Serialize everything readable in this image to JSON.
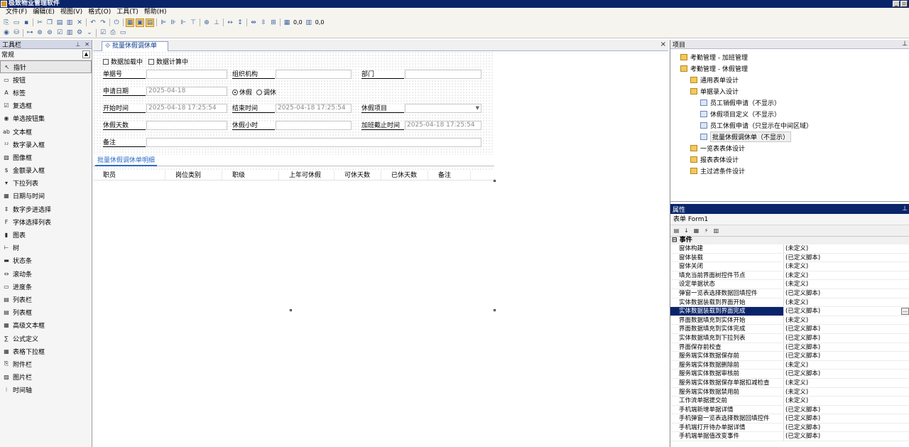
{
  "window": {
    "title": "极致物业管理软件"
  },
  "menu": [
    "文件(F)",
    "编辑(E)",
    "视图(V)",
    "格式(O)",
    "工具(T)",
    "帮助(H)"
  ],
  "toolbar": {
    "zoom_a": "0,0",
    "zoom_b": "0,0"
  },
  "toolbox": {
    "title": "工具栏",
    "category": "常规",
    "items": [
      "指针",
      "按钮",
      "标签",
      "复选框",
      "单选按钮集",
      "文本框",
      "数字录入框",
      "图像框",
      "金额录入框",
      "下拉列表",
      "日期与时间",
      "数字步进选择",
      "字体选择列表",
      "图表",
      "树",
      "状态条",
      "滚动条",
      "进度条",
      "列表栏",
      "列表框",
      "高级文本框",
      "公式定义",
      "表格下拉框",
      "附件栏",
      "图片栏",
      "时间轴"
    ]
  },
  "doc": {
    "tab_label": "批量休假调休单",
    "close_label": "×",
    "checks": [
      "数据加载中",
      "数据计算中"
    ],
    "fields": {
      "danju_hao": {
        "label": "单据号",
        "value": ""
      },
      "zuzhi": {
        "label": "组织机构",
        "value": ""
      },
      "bumen": {
        "label": "部门",
        "value": ""
      },
      "shenqing": {
        "label": "申请日期",
        "value": "2025-04-18"
      },
      "kaishi": {
        "label": "开始时间",
        "value": "2025-04-18 17:25:54"
      },
      "jieshu": {
        "label": "结束时间",
        "value": "2025-04-18 17:25:54"
      },
      "xiujia_xm": {
        "label": "休假项目",
        "value": ""
      },
      "tianshu": {
        "label": "休假天数",
        "value": ""
      },
      "xiaoshi": {
        "label": "休假小时",
        "value": ""
      },
      "jiaban_jz": {
        "label": "加班截止时间",
        "value": "2025-04-18 17:25:54"
      },
      "beizhu": {
        "label": "备注",
        "value": ""
      }
    },
    "radio": {
      "opt1": "休假",
      "opt2": "调休"
    },
    "detail_tab": "批量休假调休单明细",
    "grid_headers": [
      "职员",
      "岗位类别",
      "职级",
      "上年可休假",
      "可休天数",
      "已休天数",
      "备注"
    ]
  },
  "project": {
    "title": "项目",
    "tree": [
      {
        "label": "考勤管理 - 加班管理",
        "level": 0,
        "icon": "folder-open-icon"
      },
      {
        "label": "考勤管理 - 休假管理",
        "level": 0,
        "icon": "folder-open-icon"
      },
      {
        "label": "通用表单设计",
        "level": 1,
        "icon": "folder-icon"
      },
      {
        "label": "单据录入设计",
        "level": 1,
        "icon": "folder-icon"
      },
      {
        "label": "员工销假申请（不显示）",
        "level": 2,
        "icon": "page-icon"
      },
      {
        "label": "休假项目定义（不显示）",
        "level": 2,
        "icon": "page-icon"
      },
      {
        "label": "员工休假申请（只显示在中间区域）",
        "level": 2,
        "icon": "page-icon"
      },
      {
        "label": "批量休假调休单（不显示）",
        "level": 2,
        "icon": "page-icon",
        "selected": true
      },
      {
        "label": "一览表表体设计",
        "level": 1,
        "icon": "folder-icon"
      },
      {
        "label": "报表表体设计",
        "level": 1,
        "icon": "folder-icon"
      },
      {
        "label": "主过滤条件设计",
        "level": 1,
        "icon": "folder-icon"
      }
    ]
  },
  "props": {
    "title": "属性",
    "object": "表单 Form1",
    "category": "事件",
    "rows": [
      {
        "name": "窗体构建",
        "value": "(未定义)"
      },
      {
        "name": "窗体装载",
        "value": "(已定义脚本)"
      },
      {
        "name": "窗体关闭",
        "value": "(未定义)"
      },
      {
        "name": "填充当前界面树控件节点",
        "value": "(未定义)"
      },
      {
        "name": "设定单据状态",
        "value": "(未定义)"
      },
      {
        "name": "弹窗一览表选择数据回填控件",
        "value": "(已定义脚本)"
      },
      {
        "name": "实体数据装载到界面开始",
        "value": "(未定义)"
      },
      {
        "name": "实体数据装载到界面完成",
        "value": "(已定义脚本)",
        "selected": true
      },
      {
        "name": "界面数据填充到实体开始",
        "value": "(未定义)"
      },
      {
        "name": "界面数据填充到实体完成",
        "value": "(已定义脚本)"
      },
      {
        "name": "实体数据填充到下拉列表",
        "value": "(已定义脚本)"
      },
      {
        "name": "界面保存前校查",
        "value": "(已定义脚本)"
      },
      {
        "name": "服务端实体数据保存前",
        "value": "(已定义脚本)"
      },
      {
        "name": "服务端实体数据删除前",
        "value": "(未定义)"
      },
      {
        "name": "服务端实体数据审核前",
        "value": "(已定义脚本)"
      },
      {
        "name": "服务端实体数据保存单据扣减检查",
        "value": "(未定义)"
      },
      {
        "name": "服务端实体数据禁用前",
        "value": "(未定义)"
      },
      {
        "name": "工作流单据提交前",
        "value": "(未定义)"
      },
      {
        "name": "手机端新增单据详情",
        "value": "(已定义脚本)"
      },
      {
        "name": "手机弹窗一览表选择数据回填控件",
        "value": "(已定义脚本)"
      },
      {
        "name": "手机端打开待办单据详情",
        "value": "(已定义脚本)"
      },
      {
        "name": "手机端单据值改变事件",
        "value": "(已定义脚本)"
      }
    ]
  }
}
